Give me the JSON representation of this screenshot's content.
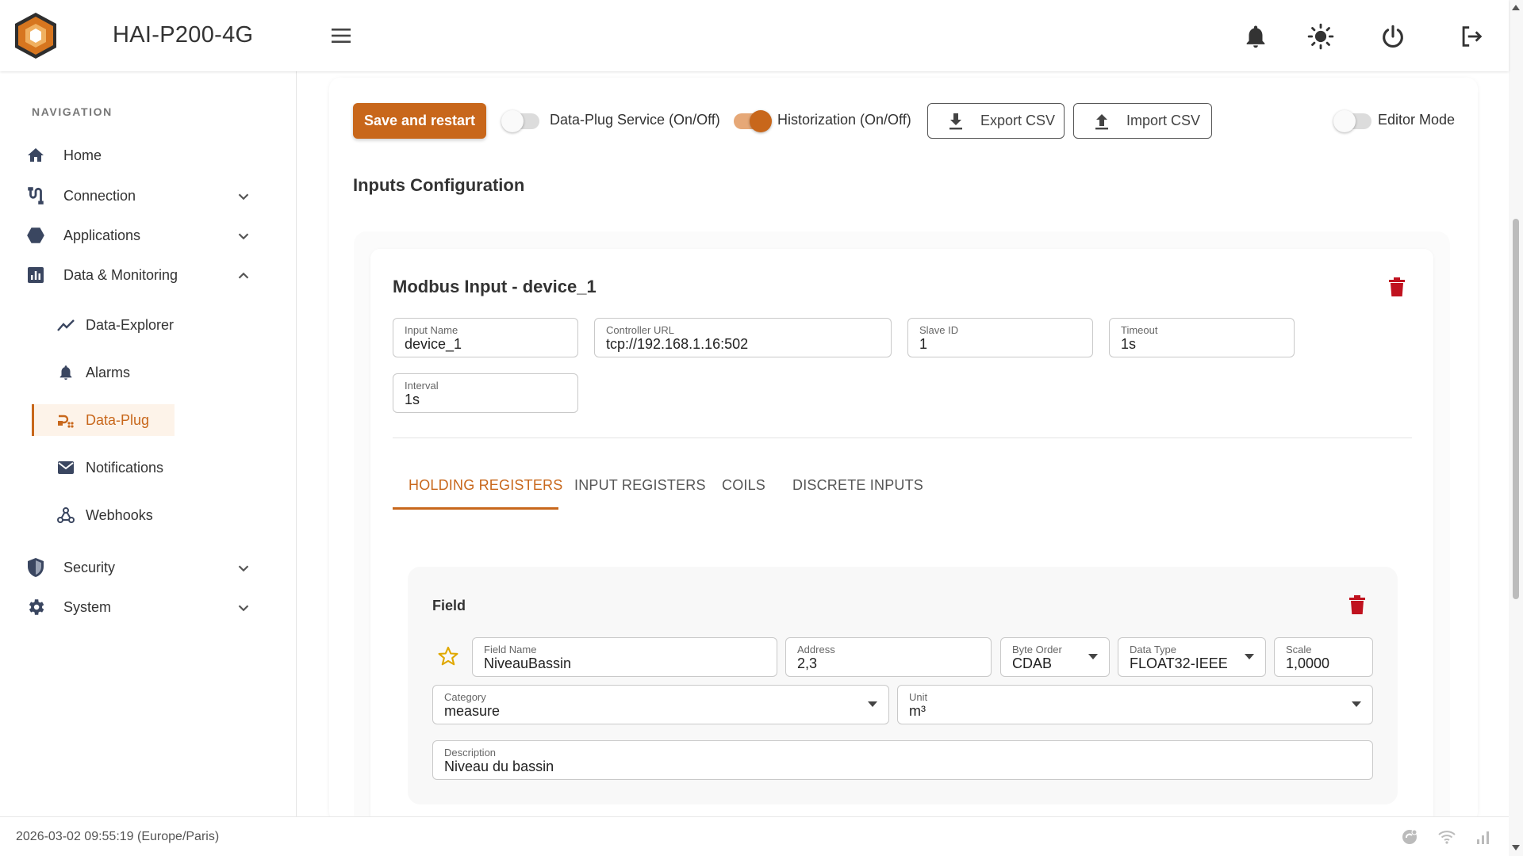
{
  "app": {
    "title": "HAI-P200-4G"
  },
  "topbar": {
    "icons": [
      "menu-icon",
      "bell-icon",
      "sun-icon",
      "power-icon",
      "logout-icon"
    ]
  },
  "sidebar": {
    "heading": "NAVIGATION",
    "items": [
      {
        "label": "Home",
        "icon": "home-icon"
      },
      {
        "label": "Connection",
        "icon": "connection-icon",
        "expandable": true
      },
      {
        "label": "Applications",
        "icon": "hexagon-icon",
        "expandable": true
      },
      {
        "label": "Data & Monitoring",
        "icon": "chart-icon",
        "expanded": true
      },
      {
        "label": "Security",
        "icon": "shield-icon",
        "expandable": true
      },
      {
        "label": "System",
        "icon": "gear-icon",
        "expandable": true
      }
    ],
    "subitems": [
      {
        "label": "Data-Explorer",
        "icon": "trend-icon"
      },
      {
        "label": "Alarms",
        "icon": "bell-icon"
      },
      {
        "label": "Data-Plug",
        "icon": "plug-icon",
        "active": true
      },
      {
        "label": "Notifications",
        "icon": "mail-icon"
      },
      {
        "label": "Webhooks",
        "icon": "webhook-icon"
      }
    ]
  },
  "toolbar": {
    "save_label": "Save and restart",
    "dataplug_service_label": "Data-Plug Service (On/Off)",
    "dataplug_service_on": false,
    "historization_label": "Historization (On/Off)",
    "historization_on": true,
    "export_label": "Export CSV",
    "import_label": "Import CSV",
    "editor_mode_label": "Editor Mode",
    "editor_mode_on": false
  },
  "page": {
    "section_title": "Inputs Configuration"
  },
  "device": {
    "title": "Modbus Input - device_1",
    "fields": {
      "input_name": {
        "label": "Input Name",
        "value": "device_1"
      },
      "controller_url": {
        "label": "Controller URL",
        "value": "tcp://192.168.1.16:502"
      },
      "slave_id": {
        "label": "Slave ID",
        "value": "1"
      },
      "timeout": {
        "label": "Timeout",
        "value": "1s"
      },
      "interval": {
        "label": "Interval",
        "value": "1s"
      }
    },
    "tabs": [
      {
        "label": "HOLDING REGISTERS",
        "active": true
      },
      {
        "label": "INPUT REGISTERS"
      },
      {
        "label": "COILS"
      },
      {
        "label": "DISCRETE INPUTS"
      }
    ]
  },
  "register_field": {
    "title": "Field",
    "field_name": {
      "label": "Field Name",
      "value": "NiveauBassin"
    },
    "address": {
      "label": "Address",
      "value": "2,3"
    },
    "byte_order": {
      "label": "Byte Order",
      "value": "CDAB"
    },
    "data_type": {
      "label": "Data Type",
      "value": "FLOAT32-IEEE"
    },
    "scale": {
      "label": "Scale",
      "value": "1,0000"
    },
    "category": {
      "label": "Category",
      "value": "measure"
    },
    "unit": {
      "label": "Unit",
      "value": "m³"
    },
    "description": {
      "label": "Description",
      "value": "Niveau du bassin"
    }
  },
  "statusbar": {
    "datetime": "2026-03-02 09:55:19 (Europe/Paris)",
    "icons": [
      "cloud-sync-icon",
      "wifi-icon",
      "signal-icon"
    ]
  },
  "colors": {
    "accent": "#c8671b",
    "danger": "#c0121f",
    "star": "#e0a800"
  }
}
